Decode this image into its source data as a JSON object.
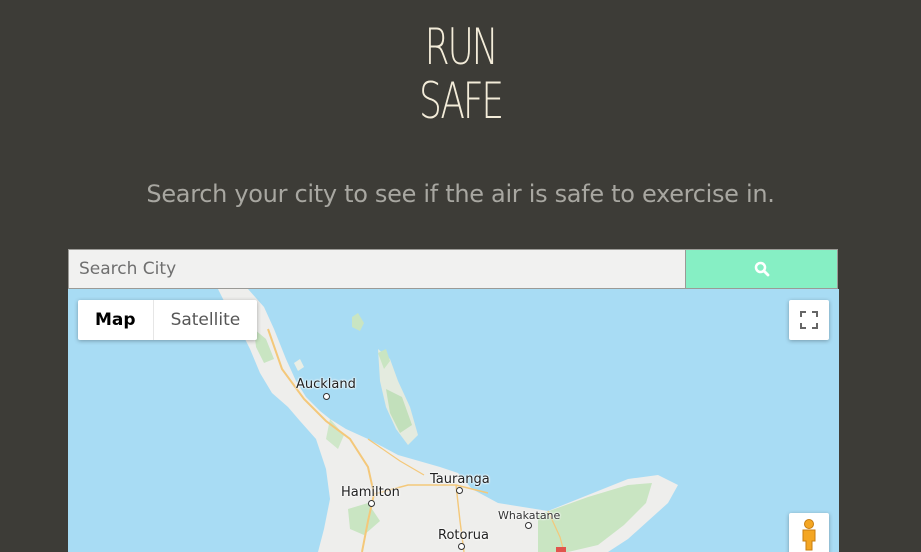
{
  "header": {
    "title_line1": "RUN",
    "title_line2": "SAFE"
  },
  "subtitle": "Search your city to see if the air is safe to exercise in.",
  "search": {
    "placeholder": "Search City",
    "button_icon": "search-icon",
    "accent_color": "#86efc4"
  },
  "map": {
    "map_type_options": [
      "Map",
      "Satellite"
    ],
    "active_map_type": "Map",
    "controls": [
      "fullscreen-icon",
      "pegman-icon"
    ],
    "cities": {
      "auckland": "Auckland",
      "tauranga": "Tauranga",
      "hamilton": "Hamilton",
      "whakatane": "Whakatane",
      "rotorua": "Rotorua"
    }
  }
}
